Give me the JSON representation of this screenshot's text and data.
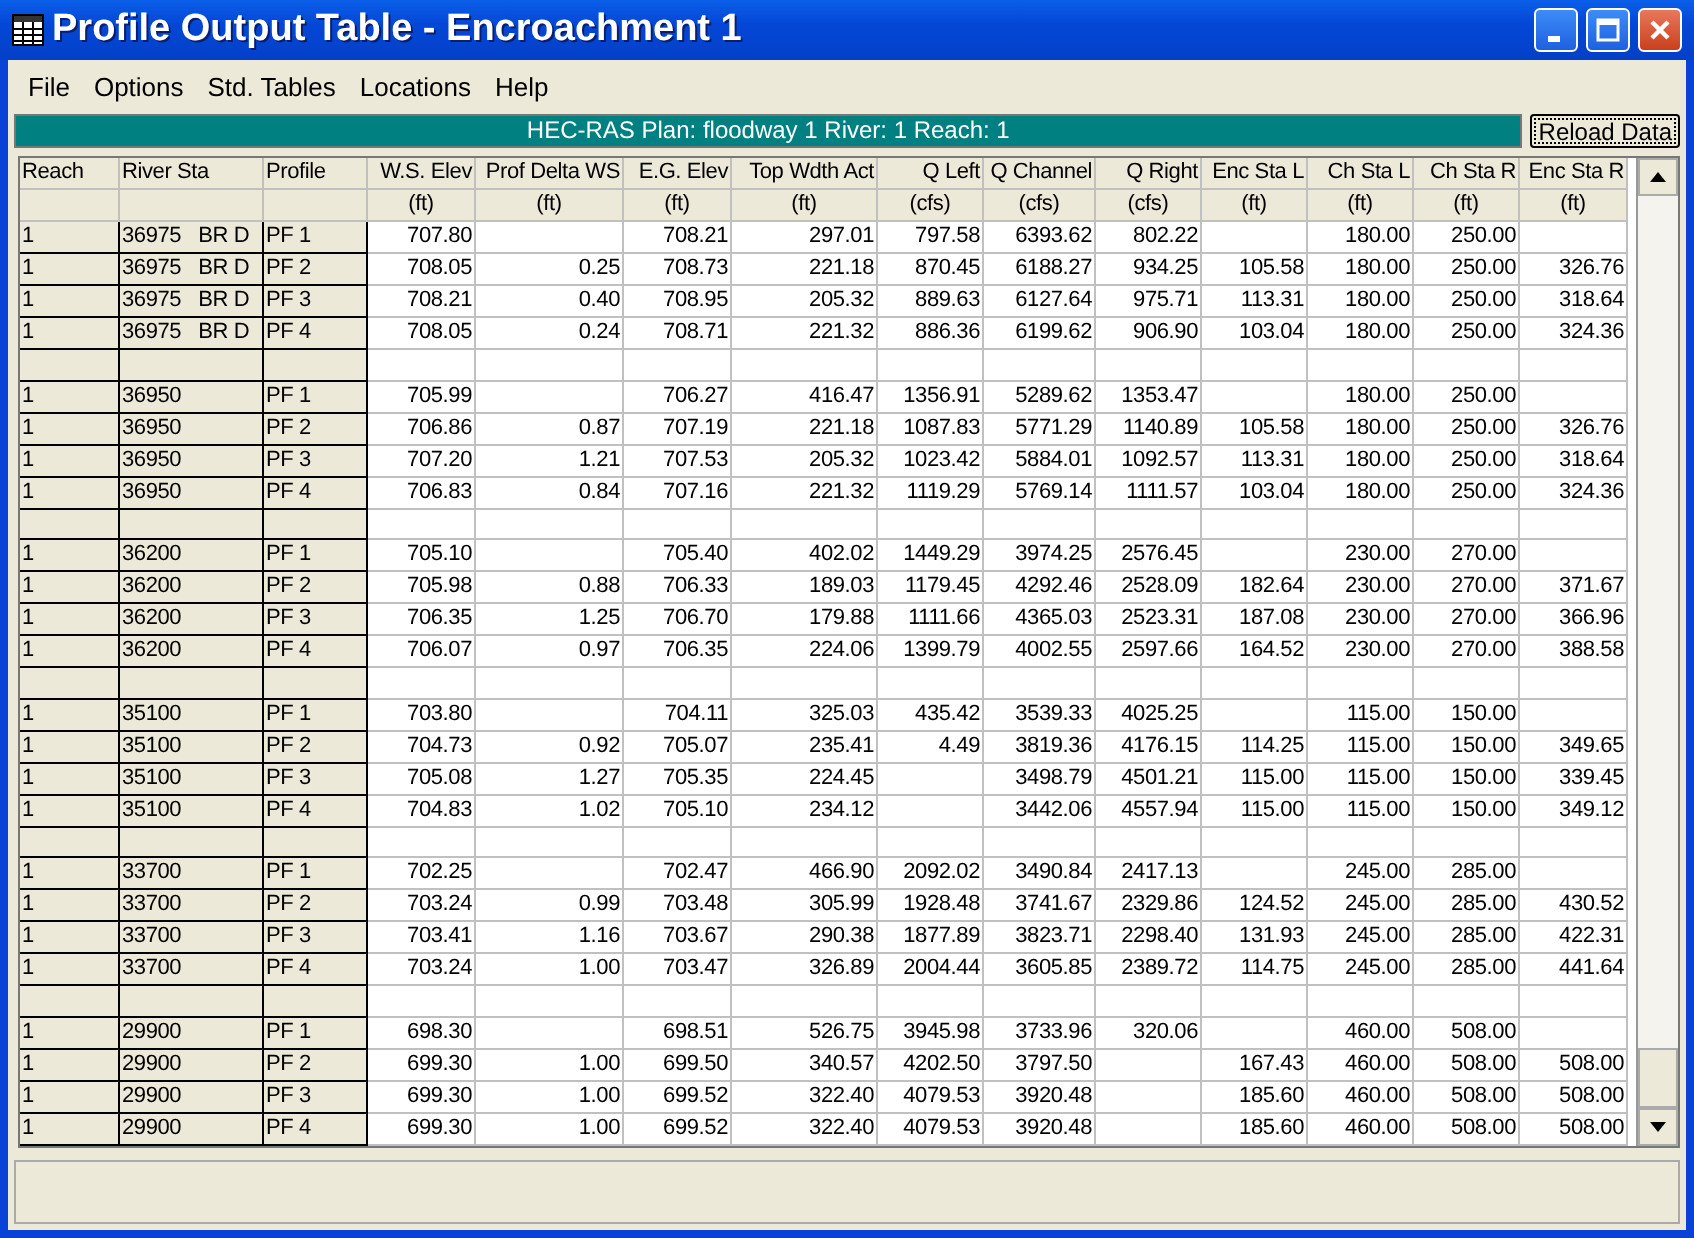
{
  "window": {
    "title": "Profile Output Table - Encroachment 1"
  },
  "menu": [
    "File",
    "Options",
    "Std. Tables",
    "Locations",
    "Help"
  ],
  "info_bar": {
    "text": "HEC-RAS  Plan: floodway 1   River: 1   Reach: 1",
    "button": "Reload Data"
  },
  "table": {
    "columns": [
      {
        "name": "Reach"
      },
      {
        "name": "River Sta"
      },
      {
        "name": "Profile"
      },
      {
        "name": "W.S. Elev",
        "unit": "(ft)"
      },
      {
        "name": "Prof Delta WS",
        "unit": "(ft)"
      },
      {
        "name": "E.G. Elev",
        "unit": "(ft)"
      },
      {
        "name": "Top Wdth Act",
        "unit": "(ft)"
      },
      {
        "name": "Q Left",
        "unit": "(cfs)"
      },
      {
        "name": "Q Channel",
        "unit": "(cfs)"
      },
      {
        "name": "Q Right",
        "unit": "(cfs)"
      },
      {
        "name": "Enc Sta L",
        "unit": "(ft)"
      },
      {
        "name": "Ch Sta L",
        "unit": "(ft)"
      },
      {
        "name": "Ch Sta R",
        "unit": "(ft)"
      },
      {
        "name": "Enc Sta R",
        "unit": "(ft)"
      }
    ],
    "rows": [
      {
        "kind": "data",
        "cells": [
          "1",
          "36975   BR D",
          "PF 1",
          "707.80",
          null,
          "708.21",
          "297.01",
          "797.58",
          "6393.62",
          "802.22",
          null,
          "180.00",
          "250.00",
          null
        ]
      },
      {
        "kind": "data",
        "cells": [
          "1",
          "36975   BR D",
          "PF 2",
          "708.05",
          "0.25",
          "708.73",
          "221.18",
          "870.45",
          "6188.27",
          "934.25",
          "105.58",
          "180.00",
          "250.00",
          "326.76"
        ]
      },
      {
        "kind": "data",
        "cells": [
          "1",
          "36975   BR D",
          "PF 3",
          "708.21",
          "0.40",
          "708.95",
          "205.32",
          "889.63",
          "6127.64",
          "975.71",
          "113.31",
          "180.00",
          "250.00",
          "318.64"
        ]
      },
      {
        "kind": "data",
        "cells": [
          "1",
          "36975   BR D",
          "PF 4",
          "708.05",
          "0.24",
          "708.71",
          "221.32",
          "886.36",
          "6199.62",
          "906.90",
          "103.04",
          "180.00",
          "250.00",
          "324.36"
        ]
      },
      {
        "kind": "blank"
      },
      {
        "kind": "data",
        "cells": [
          "1",
          "36950",
          "PF 1",
          "705.99",
          null,
          "706.27",
          "416.47",
          "1356.91",
          "5289.62",
          "1353.47",
          null,
          "180.00",
          "250.00",
          null
        ]
      },
      {
        "kind": "data",
        "cells": [
          "1",
          "36950",
          "PF 2",
          "706.86",
          "0.87",
          "707.19",
          "221.18",
          "1087.83",
          "5771.29",
          "1140.89",
          "105.58",
          "180.00",
          "250.00",
          "326.76"
        ]
      },
      {
        "kind": "data",
        "cells": [
          "1",
          "36950",
          "PF 3",
          "707.20",
          "1.21",
          "707.53",
          "205.32",
          "1023.42",
          "5884.01",
          "1092.57",
          "113.31",
          "180.00",
          "250.00",
          "318.64"
        ]
      },
      {
        "kind": "data",
        "cells": [
          "1",
          "36950",
          "PF 4",
          "706.83",
          "0.84",
          "707.16",
          "221.32",
          "1119.29",
          "5769.14",
          "1111.57",
          "103.04",
          "180.00",
          "250.00",
          "324.36"
        ]
      },
      {
        "kind": "blank"
      },
      {
        "kind": "data",
        "cells": [
          "1",
          "36200",
          "PF 1",
          "705.10",
          null,
          "705.40",
          "402.02",
          "1449.29",
          "3974.25",
          "2576.45",
          null,
          "230.00",
          "270.00",
          null
        ]
      },
      {
        "kind": "data",
        "cells": [
          "1",
          "36200",
          "PF 2",
          "705.98",
          "0.88",
          "706.33",
          "189.03",
          "1179.45",
          "4292.46",
          "2528.09",
          "182.64",
          "230.00",
          "270.00",
          "371.67"
        ]
      },
      {
        "kind": "data",
        "cells": [
          "1",
          "36200",
          "PF 3",
          "706.35",
          "1.25",
          "706.70",
          "179.88",
          "1111.66",
          "4365.03",
          "2523.31",
          "187.08",
          "230.00",
          "270.00",
          "366.96"
        ]
      },
      {
        "kind": "data",
        "cells": [
          "1",
          "36200",
          "PF 4",
          "706.07",
          "0.97",
          "706.35",
          "224.06",
          "1399.79",
          "4002.55",
          "2597.66",
          "164.52",
          "230.00",
          "270.00",
          "388.58"
        ]
      },
      {
        "kind": "blank"
      },
      {
        "kind": "data",
        "cells": [
          "1",
          "35100",
          "PF 1",
          "703.80",
          null,
          "704.11",
          "325.03",
          "435.42",
          "3539.33",
          "4025.25",
          null,
          "115.00",
          "150.00",
          null
        ]
      },
      {
        "kind": "data",
        "cells": [
          "1",
          "35100",
          "PF 2",
          "704.73",
          "0.92",
          "705.07",
          "235.41",
          "4.49",
          "3819.36",
          "4176.15",
          "114.25",
          "115.00",
          "150.00",
          "349.65"
        ]
      },
      {
        "kind": "data",
        "cells": [
          "1",
          "35100",
          "PF 3",
          "705.08",
          "1.27",
          "705.35",
          "224.45",
          null,
          "3498.79",
          "4501.21",
          "115.00",
          "115.00",
          "150.00",
          "339.45"
        ]
      },
      {
        "kind": "data",
        "cells": [
          "1",
          "35100",
          "PF 4",
          "704.83",
          "1.02",
          "705.10",
          "234.12",
          null,
          "3442.06",
          "4557.94",
          "115.00",
          "115.00",
          "150.00",
          "349.12"
        ]
      },
      {
        "kind": "blank"
      },
      {
        "kind": "data",
        "cells": [
          "1",
          "33700",
          "PF 1",
          "702.25",
          null,
          "702.47",
          "466.90",
          "2092.02",
          "3490.84",
          "2417.13",
          null,
          "245.00",
          "285.00",
          null
        ]
      },
      {
        "kind": "data",
        "cells": [
          "1",
          "33700",
          "PF 2",
          "703.24",
          "0.99",
          "703.48",
          "305.99",
          "1928.48",
          "3741.67",
          "2329.86",
          "124.52",
          "245.00",
          "285.00",
          "430.52"
        ]
      },
      {
        "kind": "data",
        "cells": [
          "1",
          "33700",
          "PF 3",
          "703.41",
          "1.16",
          "703.67",
          "290.38",
          "1877.89",
          "3823.71",
          "2298.40",
          "131.93",
          "245.00",
          "285.00",
          "422.31"
        ]
      },
      {
        "kind": "data",
        "cells": [
          "1",
          "33700",
          "PF 4",
          "703.24",
          "1.00",
          "703.47",
          "326.89",
          "2004.44",
          "3605.85",
          "2389.72",
          "114.75",
          "245.00",
          "285.00",
          "441.64"
        ]
      },
      {
        "kind": "blank"
      },
      {
        "kind": "data",
        "cells": [
          "1",
          "29900",
          "PF 1",
          "698.30",
          null,
          "698.51",
          "526.75",
          "3945.98",
          "3733.96",
          "320.06",
          null,
          "460.00",
          "508.00",
          null
        ]
      },
      {
        "kind": "data",
        "cells": [
          "1",
          "29900",
          "PF 2",
          "699.30",
          "1.00",
          "699.50",
          "340.57",
          "4202.50",
          "3797.50",
          null,
          "167.43",
          "460.00",
          "508.00",
          "508.00"
        ]
      },
      {
        "kind": "data",
        "cells": [
          "1",
          "29900",
          "PF 3",
          "699.30",
          "1.00",
          "699.52",
          "322.40",
          "4079.53",
          "3920.48",
          null,
          "185.60",
          "460.00",
          "508.00",
          "508.00"
        ]
      },
      {
        "kind": "data",
        "cells": [
          "1",
          "29900",
          "PF 4",
          "699.30",
          "1.00",
          "699.52",
          "322.40",
          "4079.53",
          "3920.48",
          null,
          "185.60",
          "460.00",
          "508.00",
          "508.00"
        ]
      }
    ]
  }
}
